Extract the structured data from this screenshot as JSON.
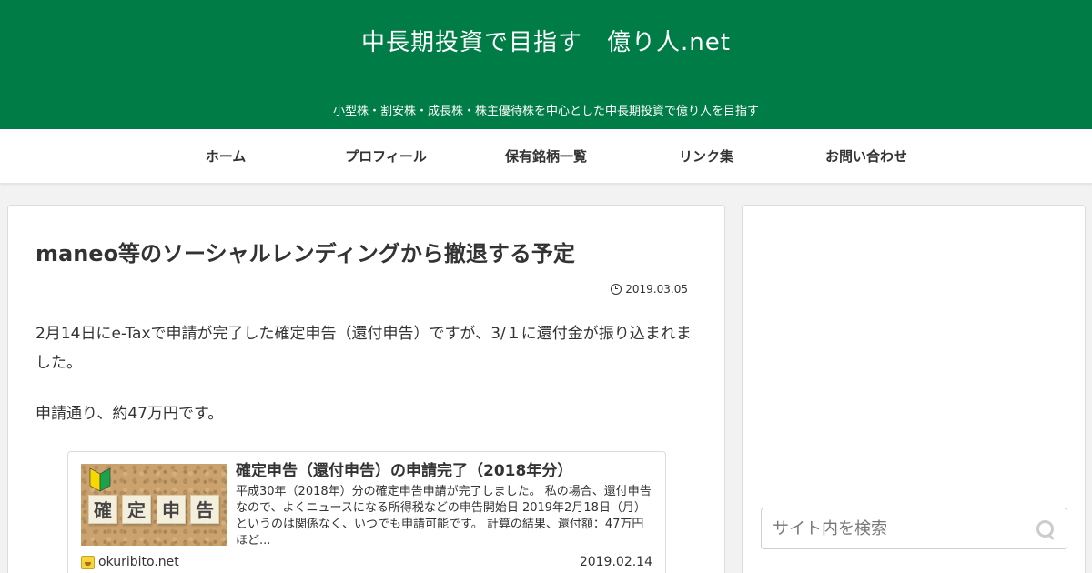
{
  "header": {
    "site_title": "中長期投資で目指す　億り人.net",
    "tagline": "小型株・割安株・成長株・株主優待株を中心とした中長期投資で億り人を目指す",
    "background_color": "#007c47"
  },
  "nav": {
    "items": [
      {
        "label": "ホーム"
      },
      {
        "label": "プロフィール"
      },
      {
        "label": "保有銘柄一覧"
      },
      {
        "label": "リンク集"
      },
      {
        "label": "お問い合わせ"
      }
    ]
  },
  "article": {
    "title": "maneo等のソーシャルレンディングから撤退する予定",
    "date": "2019.03.05",
    "paragraphs": [
      "2月14日にe-Taxで申請が完了した確定申告（還付申告）ですが、3/１に還付金が振り込まれました。",
      "申請通り、約47万円です。"
    ]
  },
  "blogcard": {
    "thumbnail_tiles": [
      "確",
      "定",
      "申",
      "告"
    ],
    "title": "確定申告（還付申告）の申請完了（2018年分）",
    "snippet": "平成30年（2018年）分の確定申告申請が完了しました。 私の場合、還付申告なので、よくニュースになる所得税などの申告開始日 2019年2月18日（月）というのは関係なく、いつでも申請可能です。 計算の結果、還付額：47万円ほど...",
    "site": "okuribito.net",
    "date": "2019.02.14"
  },
  "sidebar": {
    "search": {
      "placeholder": "サイト内を検索",
      "value": ""
    }
  }
}
